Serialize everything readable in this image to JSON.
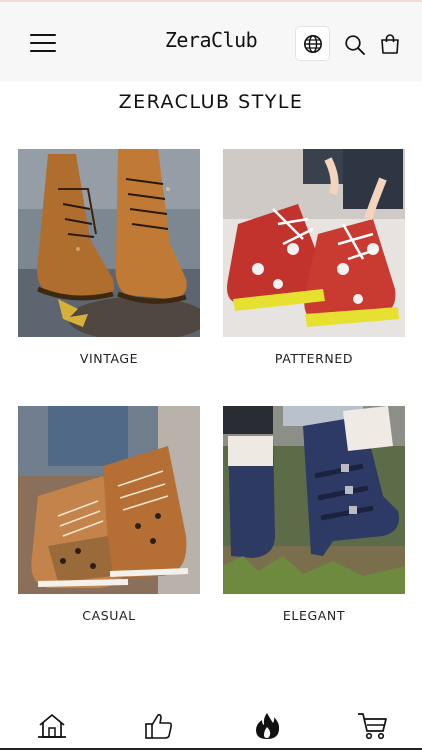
{
  "header": {
    "brand": "ZeraClub",
    "icons": [
      "menu-icon",
      "globe-icon",
      "search-icon",
      "shopping-bag-icon"
    ],
    "background": "#f7f7f7"
  },
  "section": {
    "title": "ZERACLUB STYLE"
  },
  "categories": [
    {
      "label": "VINTAGE",
      "image": "brown lace-up leather boots on wet pavement"
    },
    {
      "label": "PATTERNED",
      "image": "red patterned lace-up boots with white laces"
    },
    {
      "label": "CASUAL",
      "image": "tan and leopard print lace-up sneakers"
    },
    {
      "label": "ELEGANT",
      "image": "navy buckled heeled ankle boots with fur lining"
    }
  ],
  "bottom_nav": {
    "icons": [
      "home-icon",
      "thumbs-up-icon",
      "flame-icon",
      "cart-icon"
    ]
  }
}
